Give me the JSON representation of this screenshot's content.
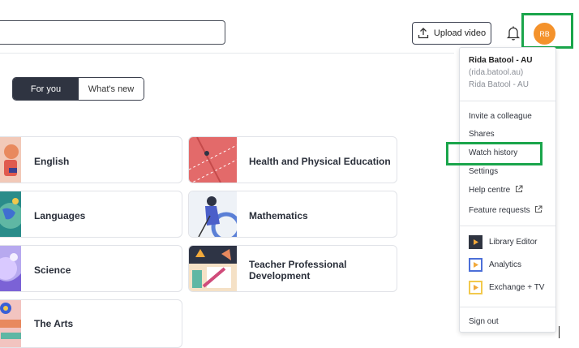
{
  "header": {
    "upload_label": "Upload video",
    "avatar_initials": "RB"
  },
  "tabs": [
    {
      "label": "For you",
      "active": true
    },
    {
      "label": "What's new",
      "active": false
    }
  ],
  "subjects": [
    {
      "label": "English"
    },
    {
      "label": "Health and Physical Education"
    },
    {
      "label": "Languages"
    },
    {
      "label": "Mathematics"
    },
    {
      "label": "Science"
    },
    {
      "label": "Teacher Professional Development"
    },
    {
      "label": "The Arts"
    }
  ],
  "menu": {
    "user_name": "Rida Batool - AU",
    "user_handle": "(rida.batool.au)",
    "user_org": "Rida Batool - AU",
    "items": [
      {
        "label": "Invite a colleague"
      },
      {
        "label": "Shares"
      },
      {
        "label": "Watch history"
      },
      {
        "label": "Settings"
      },
      {
        "label": "Help centre"
      },
      {
        "label": "Feature requests"
      }
    ],
    "products": [
      {
        "label": "Library Editor",
        "icon": "play-dark-icon"
      },
      {
        "label": "Analytics",
        "icon": "play-blue-icon"
      },
      {
        "label": "Exchange + TV",
        "icon": "play-yellow-icon"
      }
    ],
    "sign_out": "Sign out"
  },
  "colors": {
    "accent_orange": "#f4922b",
    "highlight_green": "#1aa54b",
    "tab_active": "#2f3441"
  }
}
